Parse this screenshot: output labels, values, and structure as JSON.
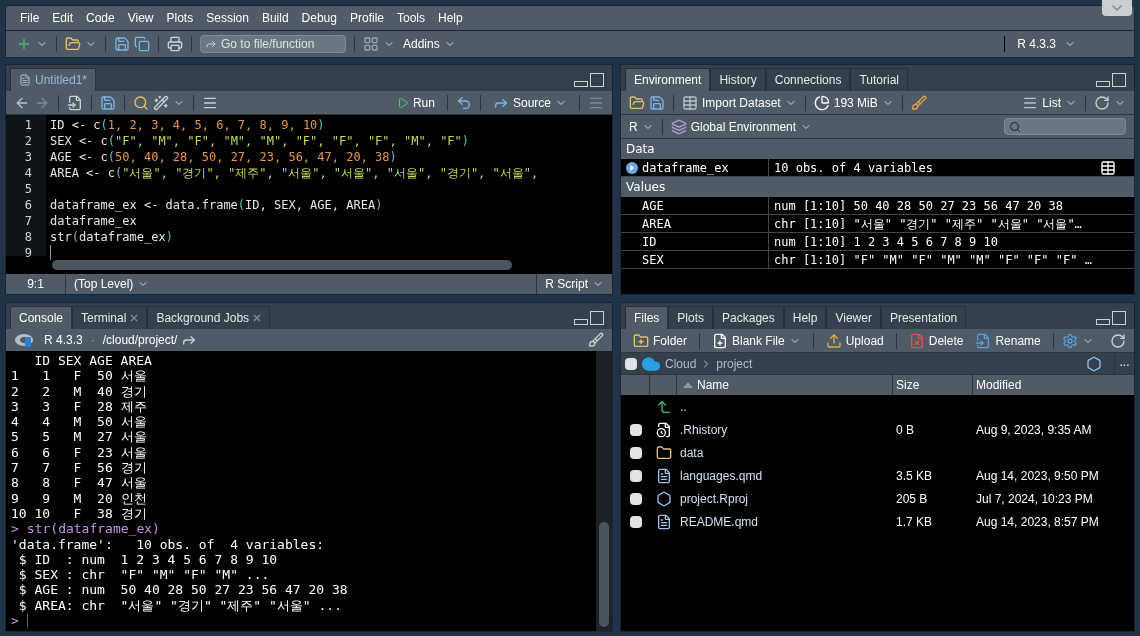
{
  "menu": [
    "File",
    "Edit",
    "Code",
    "View",
    "Plots",
    "Session",
    "Build",
    "Debug",
    "Profile",
    "Tools",
    "Help"
  ],
  "toolbar": {
    "goto_placeholder": "Go to file/function",
    "addins": "Addins",
    "r_version": "R 4.3.3"
  },
  "editor": {
    "tabs": [
      {
        "label": "Untitled1*",
        "selected": true
      }
    ],
    "run": "Run",
    "source": "Source",
    "lines": [
      {
        "number": "1",
        "tokens": [
          {
            "kind": "plain",
            "text": "ID <- c"
          },
          {
            "kind": "paren",
            "text": "("
          },
          {
            "kind": "num",
            "text": "1, 2, 3, 4, 5, 6, 7, 8, 9, 10"
          },
          {
            "kind": "paren",
            "text": ")"
          }
        ]
      },
      {
        "number": "2",
        "tokens": [
          {
            "kind": "plain",
            "text": "SEX <- c"
          },
          {
            "kind": "paren",
            "text": "("
          },
          {
            "kind": "str",
            "text": "\"F\", \"M\", \"F\", \"M\", \"M\", \"F\", \"F\", \"F\", \"M\", \"F\""
          },
          {
            "kind": "paren",
            "text": ")"
          }
        ]
      },
      {
        "number": "3",
        "tokens": [
          {
            "kind": "plain",
            "text": "AGE <- c"
          },
          {
            "kind": "paren",
            "text": "("
          },
          {
            "kind": "num",
            "text": "50, 40, 28, 50, 27, 23, 56, 47, 20, 38"
          },
          {
            "kind": "paren",
            "text": ")"
          }
        ]
      },
      {
        "number": "4",
        "tokens": [
          {
            "kind": "plain",
            "text": "AREA <- c"
          },
          {
            "kind": "paren",
            "text": "("
          },
          {
            "kind": "str",
            "text": "\"서울\", \"경기\", \"제주\", \"서울\", \"서울\", \"서울\", \"경기\", \"서울\","
          }
        ]
      },
      {
        "number": "5"
      },
      {
        "number": "6",
        "tokens": [
          {
            "kind": "plain",
            "text": "dataframe_ex <- data.frame"
          },
          {
            "kind": "paren",
            "text": "("
          },
          {
            "kind": "plain",
            "text": "ID, SEX, AGE, AREA"
          },
          {
            "kind": "paren",
            "text": ")"
          }
        ]
      },
      {
        "number": "7",
        "tokens": [
          {
            "kind": "plain",
            "text": "dataframe_ex"
          }
        ]
      },
      {
        "number": "8",
        "tokens": [
          {
            "kind": "plain",
            "text": "str"
          },
          {
            "kind": "paren",
            "text": "("
          },
          {
            "kind": "plain",
            "text": "dataframe_ex"
          },
          {
            "kind": "paren",
            "text": ")"
          }
        ]
      },
      {
        "number": "9",
        "cursor": true
      }
    ],
    "status": {
      "position": "9:1",
      "scope": "(Top Level)",
      "type": "R Script"
    }
  },
  "environment": {
    "tabs": [
      {
        "label": "Environment",
        "selected": true
      },
      {
        "label": "History",
        "selected": false
      },
      {
        "label": "Connections",
        "selected": false
      },
      {
        "label": "Tutorial",
        "selected": false
      }
    ],
    "import": "Import Dataset",
    "memory": "193 MiB",
    "view": "List",
    "language": "R",
    "scope": "Global Environment",
    "sections": [
      {
        "title": "Data",
        "rows": [
          {
            "kind": "data",
            "name": "dataframe_ex",
            "value": "10 obs. of 4 variables"
          }
        ]
      },
      {
        "title": "Values",
        "rows": [
          {
            "kind": "value",
            "name": "AGE",
            "value": "num [1:10] 50 40 28 50 27 23 56 47 20 38"
          },
          {
            "kind": "value",
            "name": "AREA",
            "value": "chr [1:10] \"서울\" \"경기\" \"제주\" \"서울\" \"서울\"…"
          },
          {
            "kind": "value",
            "name": "ID",
            "value": "num [1:10] 1 2 3 4 5 6 7 8 9 10"
          },
          {
            "kind": "value",
            "name": "SEX",
            "value": "chr [1:10] \"F\" \"M\" \"F\" \"M\" \"M\" \"F\" \"F\" \"F\" …"
          }
        ]
      }
    ]
  },
  "console": {
    "tabs": [
      {
        "label": "Console",
        "selected": true,
        "closable": false
      },
      {
        "label": "Terminal",
        "selected": false,
        "closable": true
      },
      {
        "label": "Background Jobs",
        "selected": false,
        "closable": true
      }
    ],
    "version": "R 4.3.3",
    "separator": "·",
    "path": "/cloud/project/",
    "lines": [
      {
        "kind": "output",
        "text": "   ID SEX AGE AREA"
      },
      {
        "kind": "output",
        "text": "1   1   F  50 서울"
      },
      {
        "kind": "output",
        "text": "2   2   M  40 경기"
      },
      {
        "kind": "output",
        "text": "3   3   F  28 제주"
      },
      {
        "kind": "output",
        "text": "4   4   M  50 서울"
      },
      {
        "kind": "output",
        "text": "5   5   M  27 서울"
      },
      {
        "kind": "output",
        "text": "6   6   F  23 서울"
      },
      {
        "kind": "output",
        "text": "7   7   F  56 경기"
      },
      {
        "kind": "output",
        "text": "8   8   F  47 서울"
      },
      {
        "kind": "output",
        "text": "9   9   M  20 인천"
      },
      {
        "kind": "output",
        "text": "10 10   F  38 경기"
      },
      {
        "kind": "input",
        "prompt": ">",
        "text": "str(dataframe_ex)"
      },
      {
        "kind": "output",
        "text": "'data.frame':   10 obs. of  4 variables:"
      },
      {
        "kind": "output",
        "text": " $ ID  : num  1 2 3 4 5 6 7 8 9 10"
      },
      {
        "kind": "output",
        "text": " $ SEX : chr  \"F\" \"M\" \"F\" \"M\" ..."
      },
      {
        "kind": "output",
        "text": " $ AGE : num  50 40 28 50 27 23 56 47 20 38"
      },
      {
        "kind": "output",
        "text": " $ AREA: chr  \"서울\" \"경기\" \"제주\" \"서울\" ..."
      },
      {
        "kind": "input",
        "prompt": ">",
        "cursor": true
      }
    ]
  },
  "files": {
    "tabs": [
      {
        "label": "Files",
        "selected": true
      },
      {
        "label": "Plots",
        "selected": false
      },
      {
        "label": "Packages",
        "selected": false
      },
      {
        "label": "Help",
        "selected": false
      },
      {
        "label": "Viewer",
        "selected": false
      },
      {
        "label": "Presentation",
        "selected": false
      }
    ],
    "actions": [
      {
        "kind": "folder",
        "label": "Folder"
      },
      {
        "kind": "file",
        "label": "Blank File",
        "menu": true
      },
      {
        "kind": "upload",
        "label": "Upload"
      },
      {
        "kind": "delete",
        "label": "Delete"
      },
      {
        "kind": "rename",
        "label": "Rename"
      }
    ],
    "select_all_checked": false,
    "breadcrumb": [
      "Cloud",
      "project"
    ],
    "more": "...",
    "columns": [
      "Name",
      "Size",
      "Modified"
    ],
    "rows": [
      {
        "kind": "up",
        "name": ".."
      },
      {
        "kind": "history",
        "name": ".Rhistory",
        "size": "0 B",
        "modified": "Aug 9, 2023, 9:35 AM",
        "checked": false
      },
      {
        "kind": "folder",
        "name": "data",
        "checked": false
      },
      {
        "kind": "quarto",
        "name": "languages.qmd",
        "size": "3.5 KB",
        "modified": "Aug 14, 2023, 9:50 PM",
        "checked": false
      },
      {
        "kind": "rproj",
        "name": "project.Rproj",
        "size": "205 B",
        "modified": "Jul 7, 2024, 10:23 PM",
        "checked": false
      },
      {
        "kind": "quarto",
        "name": "README.qmd",
        "size": "1.7 KB",
        "modified": "Aug 14, 2023, 8:57 PM",
        "checked": false
      }
    ]
  }
}
